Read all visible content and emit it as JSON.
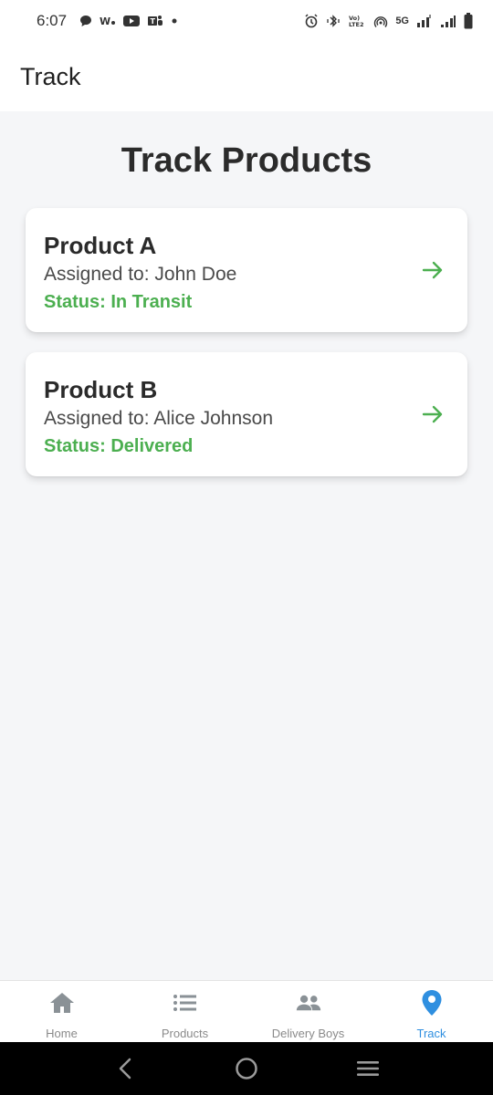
{
  "status_bar": {
    "time": "6:07",
    "network_label": "5G",
    "volte_label": "Vo))\nLTE2"
  },
  "app_bar": {
    "title": "Track"
  },
  "page": {
    "title": "Track Products"
  },
  "products": [
    {
      "name": "Product A",
      "assigned": "Assigned to: John Doe",
      "status": "Status: In Transit"
    },
    {
      "name": "Product B",
      "assigned": "Assigned to: Alice Johnson",
      "status": "Status: Delivered"
    }
  ],
  "bottom_nav": {
    "items": [
      {
        "label": "Home",
        "icon": "home-icon"
      },
      {
        "label": "Products",
        "icon": "list-icon"
      },
      {
        "label": "Delivery Boys",
        "icon": "people-icon"
      },
      {
        "label": "Track",
        "icon": "location-pin-icon"
      }
    ],
    "active_index": 3
  },
  "colors": {
    "status_green": "#4caf50",
    "active_blue": "#2f8fe0",
    "inactive_gray": "#8a8a8a"
  }
}
